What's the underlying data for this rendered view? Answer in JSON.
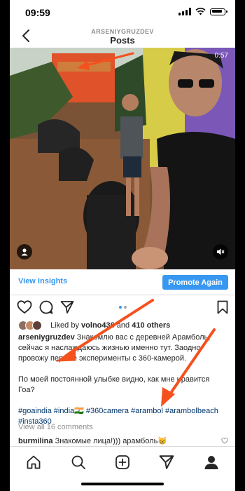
{
  "status_bar": {
    "time": "09:59"
  },
  "header": {
    "username": "ARSENIYGRUZDEV",
    "title": "Posts"
  },
  "media": {
    "duration": "0:57"
  },
  "insights": {
    "view_insights": "View Insights",
    "promote": "Promote Again"
  },
  "likes": {
    "prefix": "Liked by",
    "user": "volno436",
    "and": "and",
    "others": "410 others"
  },
  "caption": {
    "username": "arseniygruzdev",
    "text1": "Знакомлю вас с деревней Арамболь, сейчас я наслаждаюсь жизнью именно тут. Заодно провожу первые эксперименты с 360-камерой.",
    "text2": "По моей постоянной улыбке видно, как мне нравится Гоа?",
    "hashtags": "#goaindia #india🇮🇳 #360camera #arambol #arambolbeach #insta360"
  },
  "comments": {
    "view_all": "View all 16 comments",
    "user": "burmilina",
    "text": "Знакомые лица!))) арамболь😸"
  },
  "colors": {
    "accent": "#3897f0",
    "annotation": "#f4511e"
  },
  "icons": [
    "back-arrow-icon",
    "like-heart-icon",
    "comment-icon",
    "share-icon",
    "bookmark-icon",
    "home-icon",
    "search-icon",
    "new-post-icon",
    "activity-icon",
    "profile-icon"
  ]
}
